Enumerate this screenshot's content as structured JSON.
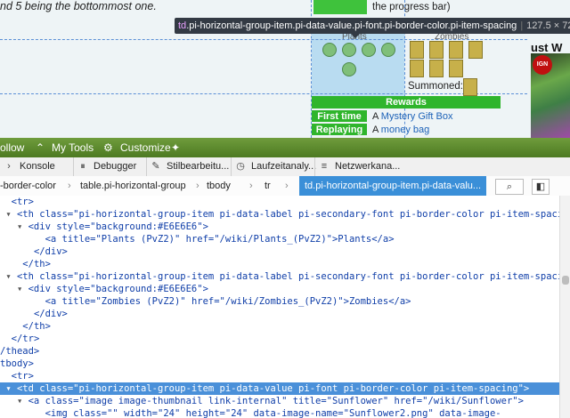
{
  "page": {
    "lead_text": "nd 5 being the bottommost one.",
    "progress_text": "the progress bar)",
    "tooltip": {
      "tag": "td",
      "classes": ".pi-horizontal-group-item.pi-data-value.pi-font.pi-border-color.pi-item-spacing",
      "dims": "127.5 × 72"
    },
    "zombies_label": "Zombies",
    "plants_label": "Plants",
    "summoned_label": "Summoned:",
    "rewards": {
      "title": "Rewards",
      "rows": [
        {
          "key": "First time",
          "pre": "A ",
          "link": "Mystery Gift Box"
        },
        {
          "key": "Replaying",
          "pre": "A ",
          "link": "money bag"
        }
      ]
    },
    "ad_heading": "ust W",
    "ad_logo": "IGN"
  },
  "bookbar": {
    "follow": "ollow",
    "my_tools": "My Tools",
    "customize": "Customize"
  },
  "devtools": {
    "tabs": [
      "Konsole",
      "Debugger",
      "Stilbearbeitu...",
      "Laufzeitanaly...",
      "Netzwerkana..."
    ],
    "tab_icons": [
      "console-icon",
      "debugger-icon",
      "style-editor-icon",
      "performance-icon",
      "network-icon"
    ]
  },
  "breadcrumbs": {
    "items": [
      "-border-color",
      "table.pi-horizontal-group",
      "tbody",
      "tr"
    ],
    "active": "td.pi-horizontal-group-item.pi-data-valu..."
  },
  "markup": {
    "lines": [
      {
        "t": "<tr>"
      },
      {
        "t": "<th class=\"pi-horizontal-group-item pi-data-label pi-secondary-font pi-border-color pi-item-spacing\">"
      },
      {
        "t": "<div style=\"background:#E6E6E6\">"
      },
      {
        "t": "<a title=\"Plants (PvZ2)\" href=\"/wiki/Plants_(PvZ2)\">Plants</a>"
      },
      {
        "t": "</div>"
      },
      {
        "t": "</th>"
      },
      {
        "t": "<th class=\"pi-horizontal-group-item pi-data-label pi-secondary-font pi-border-color pi-item-spacing\">"
      },
      {
        "t": "<div style=\"background:#E6E6E6\">"
      },
      {
        "t": "<a title=\"Zombies (PvZ2)\" href=\"/wiki/Zombies_(PvZ2)\">Zombies</a>"
      },
      {
        "t": "</div>"
      },
      {
        "t": "</th>"
      },
      {
        "t": "</tr>"
      },
      {
        "t": "/thead>"
      },
      {
        "t": "tbody>"
      },
      {
        "t": "<tr>"
      },
      {
        "t": "<td class=\"pi-horizontal-group-item pi-data-value pi-font pi-border-color pi-item-spacing\">"
      },
      {
        "t": "<a class=\"image image-thumbnail link-internal\" title=\"Sunflower\" href=\"/wiki/Sunflower\">"
      },
      {
        "t": "<img class=\"\" width=\"24\" height=\"24\" data-image-name=\"Sunflower2.png\" data-image-"
      }
    ]
  },
  "colors": {
    "accent_green": "#2fb52c",
    "selection_blue": "#4a90d9",
    "tooltip_bg": "#333a44"
  }
}
